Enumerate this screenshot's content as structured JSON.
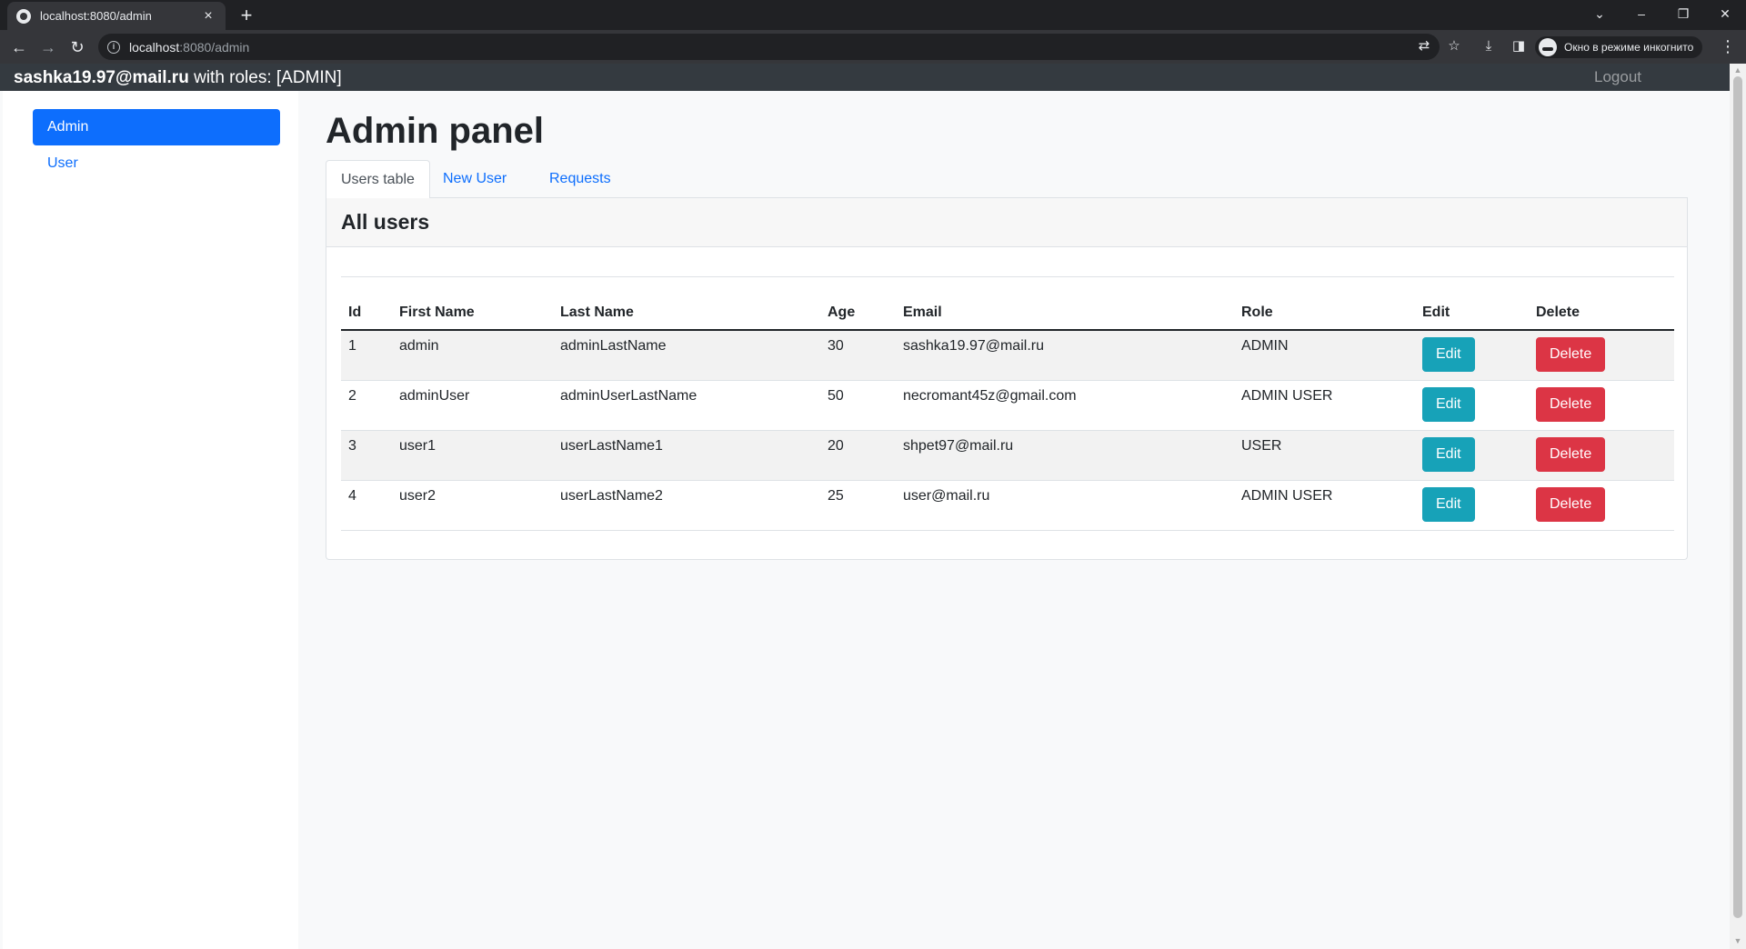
{
  "browser": {
    "tab_title": "localhost:8080/admin",
    "close_glyph": "×",
    "new_tab_glyph": "+",
    "url_host": "localhost",
    "url_path": ":8080/admin",
    "incognito_label": "Окно в режиме инкогнито",
    "icons": [
      "back-icon",
      "forward-icon",
      "reload-icon",
      "info-icon",
      "translate-icon",
      "star-icon",
      "download-icon",
      "side-panel-icon",
      "incognito-icon",
      "menu-icon",
      "minimize-icon",
      "restore-icon",
      "close-icon",
      "tab-search-icon"
    ]
  },
  "navbar": {
    "email": "sashka19.97@mail.ru",
    "roles_text": " with roles: [ADMIN]",
    "logout": "Logout"
  },
  "sidebar": {
    "items": [
      {
        "label": "Admin",
        "active": true
      },
      {
        "label": "User",
        "active": false
      }
    ]
  },
  "main": {
    "title": "Admin panel",
    "tabs": [
      {
        "label": "Users table",
        "active": true
      },
      {
        "label": "New User",
        "active": false
      },
      {
        "label": "Requests",
        "active": false
      }
    ],
    "card_title": "All users"
  },
  "table": {
    "headers": [
      "Id",
      "First Name",
      "Last Name",
      "Age",
      "Email",
      "Role",
      "Edit",
      "Delete"
    ],
    "edit_label": "Edit",
    "delete_label": "Delete",
    "rows": [
      {
        "id": "1",
        "first": "admin",
        "last": "adminLastName",
        "age": "30",
        "email": "sashka19.97@mail.ru",
        "role": "ADMIN"
      },
      {
        "id": "2",
        "first": "adminUser",
        "last": "adminUserLastName",
        "age": "50",
        "email": "necromant45z@gmail.com",
        "role": "ADMIN USER"
      },
      {
        "id": "3",
        "first": "user1",
        "last": "userLastName1",
        "age": "20",
        "email": "shpet97@mail.ru",
        "role": "USER"
      },
      {
        "id": "4",
        "first": "user2",
        "last": "userLastName2",
        "age": "25",
        "email": "user@mail.ru",
        "role": "ADMIN USER"
      }
    ]
  },
  "colors": {
    "primary": "#0d6efd",
    "edit": "#17a2b8",
    "delete": "#dc3545",
    "navbar": "#343a40"
  }
}
